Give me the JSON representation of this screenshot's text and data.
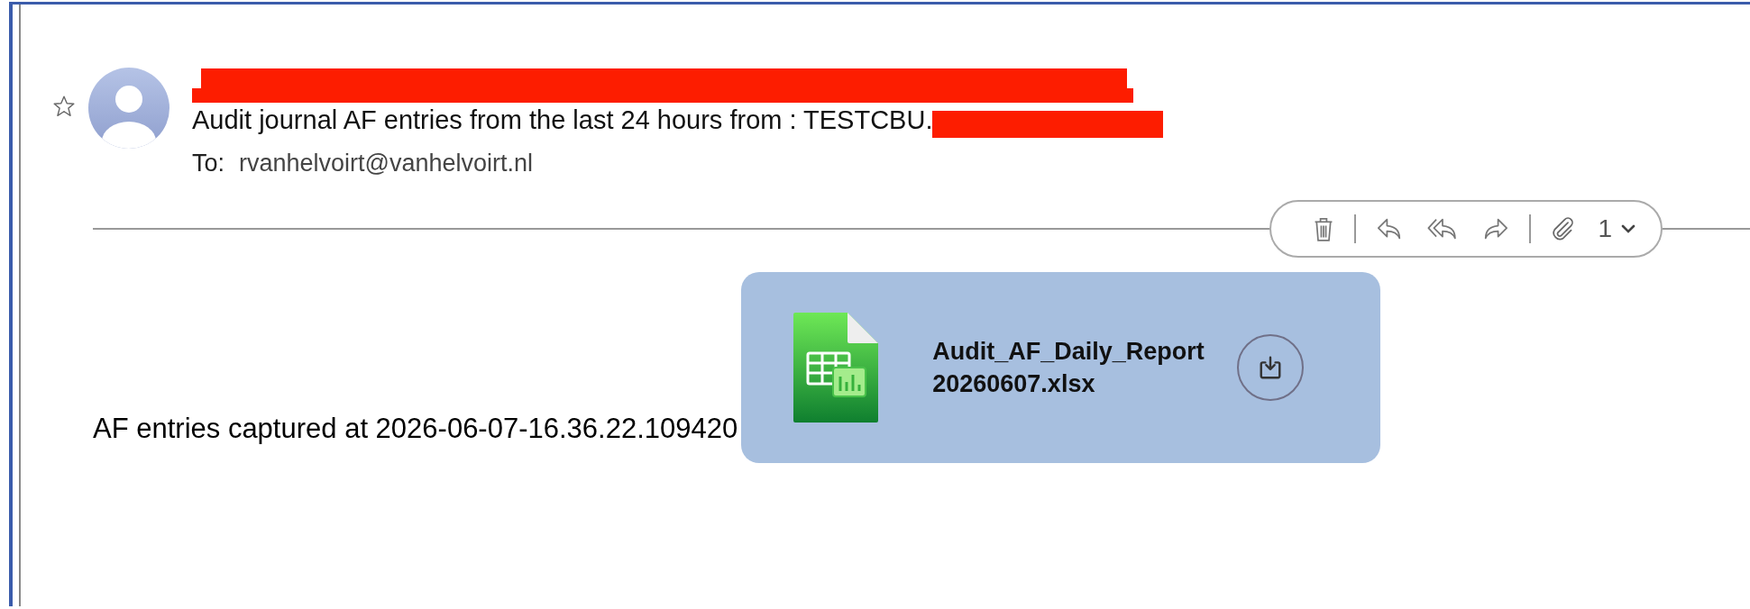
{
  "message": {
    "starred": false,
    "subject": "Audit journal AF entries from the last 24 hours from : TESTCBU.",
    "to_label": "To:",
    "to": "rvanhelvoirt@vanhelvoirt.nl"
  },
  "toolbar": {
    "attachment_count": "1"
  },
  "body_text": "AF entries captured at 2026-06-07-16.36.22.109420",
  "attachment": {
    "filename_lines": [
      "Audit_AF_Daily_Report",
      "20260607.xlsx"
    ]
  }
}
